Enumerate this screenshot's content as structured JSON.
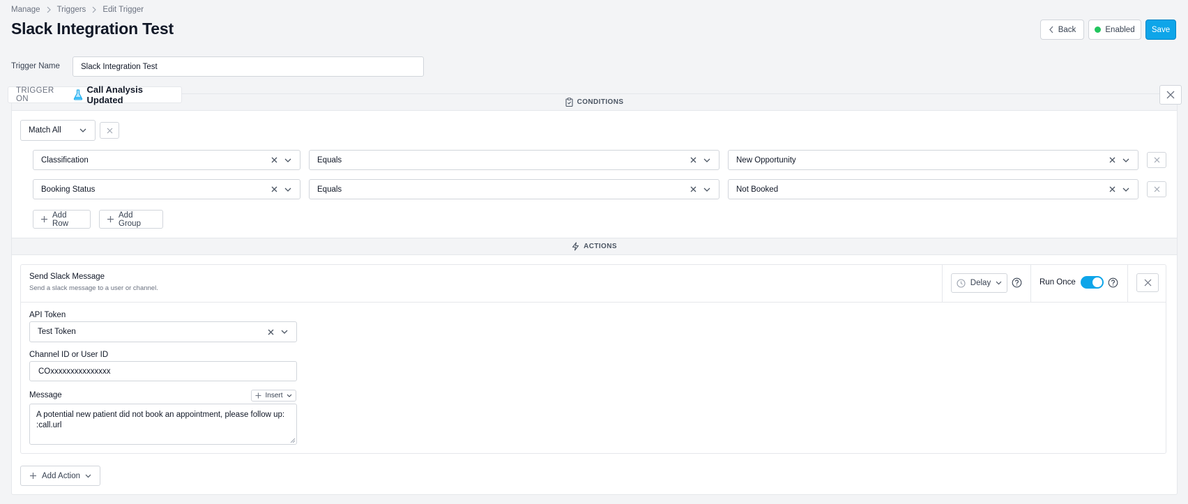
{
  "breadcrumb": [
    "Manage",
    "Triggers",
    "Edit Trigger"
  ],
  "page_title": "Slack Integration Test",
  "header": {
    "back_label": "Back",
    "enabled_label": "Enabled",
    "save_label": "Save",
    "enabled_color": "#22c55e",
    "accent_color": "#0ea5e9"
  },
  "trigger_name": {
    "label": "Trigger Name",
    "value": "Slack Integration Test"
  },
  "trigger_on": {
    "label": "TRIGGER ON",
    "value": "Call Analysis Updated",
    "icon": "flask-icon"
  },
  "conditions": {
    "section_label": "CONDITIONS",
    "match": "Match All",
    "rows": [
      {
        "field": "Classification",
        "operator": "Equals",
        "value": "New Opportunity"
      },
      {
        "field": "Booking Status",
        "operator": "Equals",
        "value": "Not Booked"
      }
    ],
    "add_row_label": "Add Row",
    "add_group_label": "Add Group"
  },
  "actions": {
    "section_label": "ACTIONS",
    "items": [
      {
        "title": "Send Slack Message",
        "description": "Send a slack message to a user or channel.",
        "delay_label": "Delay",
        "run_once_label": "Run Once",
        "run_once": true,
        "api_token_label": "API Token",
        "api_token_value": "Test Token",
        "channel_label": "Channel ID or User ID",
        "channel_value": "COxxxxxxxxxxxxxxx",
        "message_label": "Message",
        "insert_label": "Insert",
        "message_value": "A potential new patient did not book an appointment, please follow up:\n:call.url"
      }
    ],
    "add_action_label": "Add Action"
  }
}
